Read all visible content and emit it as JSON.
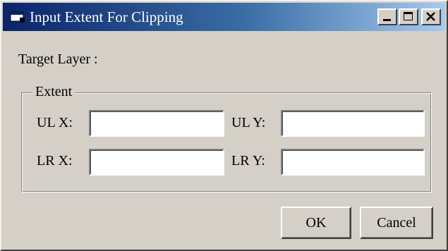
{
  "window": {
    "title": "Input Extent For Clipping",
    "icon": "app-window-icon",
    "controls": [
      "minimize-icon",
      "maximize-icon",
      "close-icon"
    ]
  },
  "target_layer": {
    "label": "Target Layer :"
  },
  "extent": {
    "legend": "Extent",
    "ul_x": {
      "label": "UL X:",
      "value": ""
    },
    "ul_y": {
      "label": "UL Y:",
      "value": ""
    },
    "lr_x": {
      "label": "LR X:",
      "value": ""
    },
    "lr_y": {
      "label": "LR Y:",
      "value": ""
    }
  },
  "buttons": {
    "ok": "OK",
    "cancel": "Cancel"
  },
  "colors": {
    "titlebar_start": "#0a246a",
    "titlebar_end": "#a6caf0",
    "dialog_face": "#d4d0c8"
  }
}
